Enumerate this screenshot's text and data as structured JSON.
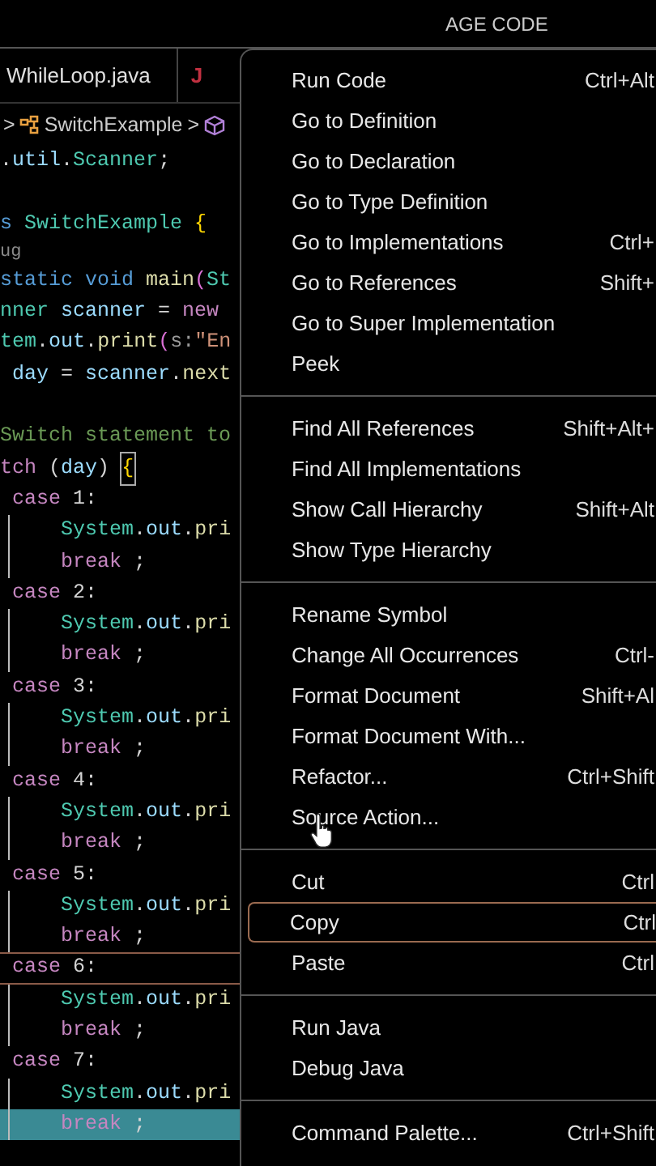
{
  "title_bar": {
    "title": "AGE CODE"
  },
  "tabs": [
    {
      "label": "WhileLoop.java",
      "selected": false
    },
    {
      "label": "J",
      "selected": false
    }
  ],
  "breadcrumb": [
    {
      "kind": "chevron",
      "text": ">"
    },
    {
      "kind": "class",
      "text": "SwitchExample"
    },
    {
      "kind": "chevron",
      "text": ">"
    },
    {
      "kind": "method"
    }
  ],
  "code_lines": [
    {
      "kind": "code",
      "current": false,
      "selected": false,
      "tokens": [
        {
          "t": ".",
          "kind": "plain"
        },
        {
          "t": "util",
          "kind": "var"
        },
        {
          "t": ".",
          "kind": "plain"
        },
        {
          "t": "Scanner",
          "kind": "type"
        },
        {
          "t": ";",
          "kind": "plain"
        }
      ]
    },
    {
      "kind": "blank",
      "current": false,
      "selected": false
    },
    {
      "kind": "code",
      "current": false,
      "selected": false,
      "tokens": [
        {
          "t": "s",
          "kind": "storage"
        },
        {
          "t": "SwitchExample",
          "kind": "type"
        },
        {
          "t": "{",
          "kind": "brace"
        }
      ]
    },
    {
      "kind": "lens",
      "current": false,
      "selected": false,
      "tokens": [
        {
          "t": "ug",
          "kind": "lens"
        }
      ]
    },
    {
      "kind": "code",
      "current": false,
      "selected": false,
      "tokens": [
        {
          "t": "static void",
          "kind": "storage"
        },
        {
          "t": "main",
          "kind": "func"
        },
        {
          "t": "(",
          "kind": "paren"
        },
        {
          "t": "St",
          "kind": "type"
        }
      ]
    },
    {
      "kind": "code",
      "current": false,
      "selected": false,
      "tokens": [
        {
          "t": "nner",
          "kind": "type"
        },
        {
          "t": "scanner",
          "kind": "var"
        },
        {
          "t": "=",
          "kind": "plain"
        },
        {
          "t": "new",
          "kind": "keyword"
        }
      ]
    },
    {
      "kind": "code",
      "current": false,
      "selected": false,
      "tokens": [
        {
          "t": "tem",
          "kind": "type"
        },
        {
          "t": ".",
          "kind": "plain"
        },
        {
          "t": "out",
          "kind": "var"
        },
        {
          "t": ".",
          "kind": "plain"
        },
        {
          "t": "print",
          "kind": "func"
        },
        {
          "t": "(",
          "kind": "paren"
        },
        {
          "t": "s:",
          "kind": "param"
        },
        {
          "t": "\"En",
          "kind": "string"
        }
      ]
    },
    {
      "kind": "case",
      "current": false,
      "selected": false,
      "tokens": [
        {
          "t": "day",
          "kind": "var"
        },
        {
          "t": "=",
          "kind": "plain"
        },
        {
          "t": "scanner",
          "kind": "var"
        },
        {
          "t": ".",
          "kind": "plain"
        },
        {
          "t": "next",
          "kind": "func"
        }
      ]
    },
    {
      "kind": "blank",
      "current": false,
      "selected": false
    },
    {
      "kind": "code",
      "current": false,
      "selected": false,
      "tokens": [
        {
          "t": "Switch statement to",
          "kind": "comment"
        }
      ]
    },
    {
      "kind": "code",
      "current": false,
      "selected": false,
      "tokens": [
        {
          "t": "tch",
          "kind": "keyword"
        },
        {
          "t": "(",
          "kind": "plain"
        },
        {
          "t": "day",
          "kind": "var"
        },
        {
          "t": ")",
          "kind": "plain"
        },
        {
          "t": "{",
          "kind": "match"
        }
      ]
    },
    {
      "kind": "case",
      "current": false,
      "selected": false,
      "tokens": [
        {
          "t": "case",
          "kind": "keyword"
        },
        {
          "t": "1:",
          "kind": "plain"
        }
      ]
    },
    {
      "kind": "body",
      "current": false,
      "selected": false,
      "tokens": [
        {
          "t": "System",
          "kind": "type"
        },
        {
          "t": ".",
          "kind": "plain"
        },
        {
          "t": "out",
          "kind": "var"
        },
        {
          "t": ".",
          "kind": "plain"
        },
        {
          "t": "pri",
          "kind": "func"
        }
      ]
    },
    {
      "kind": "body",
      "current": false,
      "selected": false,
      "tokens": [
        {
          "t": "break",
          "kind": "keyword"
        },
        {
          "t": ";",
          "kind": "plain"
        }
      ]
    },
    {
      "kind": "case",
      "current": false,
      "selected": false,
      "tokens": [
        {
          "t": "case",
          "kind": "keyword"
        },
        {
          "t": "2:",
          "kind": "plain"
        }
      ]
    },
    {
      "kind": "body",
      "current": false,
      "selected": false,
      "tokens": [
        {
          "t": "System",
          "kind": "type"
        },
        {
          "t": ".",
          "kind": "plain"
        },
        {
          "t": "out",
          "kind": "var"
        },
        {
          "t": ".",
          "kind": "plain"
        },
        {
          "t": "pri",
          "kind": "func"
        }
      ]
    },
    {
      "kind": "body",
      "current": false,
      "selected": false,
      "tokens": [
        {
          "t": "break",
          "kind": "keyword"
        },
        {
          "t": ";",
          "kind": "plain"
        }
      ]
    },
    {
      "kind": "case",
      "current": false,
      "selected": false,
      "tokens": [
        {
          "t": "case",
          "kind": "keyword"
        },
        {
          "t": "3:",
          "kind": "plain"
        }
      ]
    },
    {
      "kind": "body",
      "current": false,
      "selected": false,
      "tokens": [
        {
          "t": "System",
          "kind": "type"
        },
        {
          "t": ".",
          "kind": "plain"
        },
        {
          "t": "out",
          "kind": "var"
        },
        {
          "t": ".",
          "kind": "plain"
        },
        {
          "t": "pri",
          "kind": "func"
        }
      ]
    },
    {
      "kind": "body",
      "current": false,
      "selected": false,
      "tokens": [
        {
          "t": "break",
          "kind": "keyword"
        },
        {
          "t": ";",
          "kind": "plain"
        }
      ]
    },
    {
      "kind": "case",
      "current": false,
      "selected": false,
      "tokens": [
        {
          "t": "case",
          "kind": "keyword"
        },
        {
          "t": "4:",
          "kind": "plain"
        }
      ]
    },
    {
      "kind": "body",
      "current": false,
      "selected": false,
      "tokens": [
        {
          "t": "System",
          "kind": "type"
        },
        {
          "t": ".",
          "kind": "plain"
        },
        {
          "t": "out",
          "kind": "var"
        },
        {
          "t": ".",
          "kind": "plain"
        },
        {
          "t": "pri",
          "kind": "func"
        }
      ]
    },
    {
      "kind": "body",
      "current": false,
      "selected": false,
      "tokens": [
        {
          "t": "break",
          "kind": "keyword"
        },
        {
          "t": ";",
          "kind": "plain"
        }
      ]
    },
    {
      "kind": "case",
      "current": false,
      "selected": false,
      "tokens": [
        {
          "t": "case",
          "kind": "keyword"
        },
        {
          "t": "5:",
          "kind": "plain"
        }
      ]
    },
    {
      "kind": "body",
      "current": false,
      "selected": false,
      "tokens": [
        {
          "t": "System",
          "kind": "type"
        },
        {
          "t": ".",
          "kind": "plain"
        },
        {
          "t": "out",
          "kind": "var"
        },
        {
          "t": ".",
          "kind": "plain"
        },
        {
          "t": "pri",
          "kind": "func"
        }
      ]
    },
    {
      "kind": "body",
      "current": false,
      "selected": false,
      "tokens": [
        {
          "t": "break",
          "kind": "keyword"
        },
        {
          "t": ";",
          "kind": "plain"
        }
      ]
    },
    {
      "kind": "case",
      "current": true,
      "selected": false,
      "tokens": [
        {
          "t": "case",
          "kind": "keyword"
        },
        {
          "t": "6:",
          "kind": "plain"
        }
      ]
    },
    {
      "kind": "body",
      "current": false,
      "selected": false,
      "tokens": [
        {
          "t": "System",
          "kind": "type"
        },
        {
          "t": ".",
          "kind": "plain"
        },
        {
          "t": "out",
          "kind": "var"
        },
        {
          "t": ".",
          "kind": "plain"
        },
        {
          "t": "pri",
          "kind": "func"
        }
      ]
    },
    {
      "kind": "body",
      "current": false,
      "selected": false,
      "tokens": [
        {
          "t": "break",
          "kind": "keyword"
        },
        {
          "t": ";",
          "kind": "plain"
        }
      ]
    },
    {
      "kind": "case",
      "current": false,
      "selected": false,
      "tokens": [
        {
          "t": "case",
          "kind": "keyword"
        },
        {
          "t": "7:",
          "kind": "plain"
        }
      ]
    },
    {
      "kind": "body",
      "current": false,
      "selected": false,
      "tokens": [
        {
          "t": "System",
          "kind": "type"
        },
        {
          "t": ".",
          "kind": "plain"
        },
        {
          "t": "out",
          "kind": "var"
        },
        {
          "t": ".",
          "kind": "plain"
        },
        {
          "t": "pri",
          "kind": "func"
        }
      ]
    },
    {
      "kind": "body",
      "current": false,
      "selected": true,
      "tokens": [
        {
          "t": "break",
          "kind": "keyword"
        },
        {
          "t": ";",
          "kind": "plain"
        }
      ]
    }
  ],
  "context_menu": {
    "groups": [
      [
        {
          "label": "Run Code",
          "shortcut": "Ctrl+Alt",
          "selected": false
        },
        {
          "label": "Go to Definition",
          "selected": false
        },
        {
          "label": "Go to Declaration",
          "selected": false
        },
        {
          "label": "Go to Type Definition",
          "selected": false
        },
        {
          "label": "Go to Implementations",
          "shortcut": "Ctrl+",
          "selected": false
        },
        {
          "label": "Go to References",
          "shortcut": "Shift+",
          "selected": false
        },
        {
          "label": "Go to Super Implementation",
          "selected": false
        },
        {
          "label": "Peek",
          "selected": false
        }
      ],
      [
        {
          "label": "Find All References",
          "shortcut": "Shift+Alt+",
          "selected": false
        },
        {
          "label": "Find All Implementations",
          "selected": false
        },
        {
          "label": "Show Call Hierarchy",
          "shortcut": "Shift+Alt",
          "selected": false
        },
        {
          "label": "Show Type Hierarchy",
          "selected": false
        }
      ],
      [
        {
          "label": "Rename Symbol",
          "selected": false
        },
        {
          "label": "Change All Occurrences",
          "shortcut": "Ctrl-",
          "selected": false
        },
        {
          "label": "Format Document",
          "shortcut": "Shift+Al",
          "selected": false
        },
        {
          "label": "Format Document With...",
          "selected": false
        },
        {
          "label": "Refactor...",
          "shortcut": "Ctrl+Shift",
          "selected": false
        },
        {
          "label": "Source Action...",
          "selected": false
        }
      ],
      [
        {
          "label": "Cut",
          "shortcut": "Ctrl",
          "selected": false
        },
        {
          "label": "Copy",
          "shortcut": "Ctrl",
          "selected": true
        },
        {
          "label": "Paste",
          "shortcut": "Ctrl",
          "selected": false
        }
      ],
      [
        {
          "label": "Run Java",
          "selected": false
        },
        {
          "label": "Debug Java",
          "selected": false
        }
      ],
      [
        {
          "label": "Command Palette...",
          "shortcut": "Ctrl+Shift",
          "selected": false
        }
      ]
    ]
  }
}
